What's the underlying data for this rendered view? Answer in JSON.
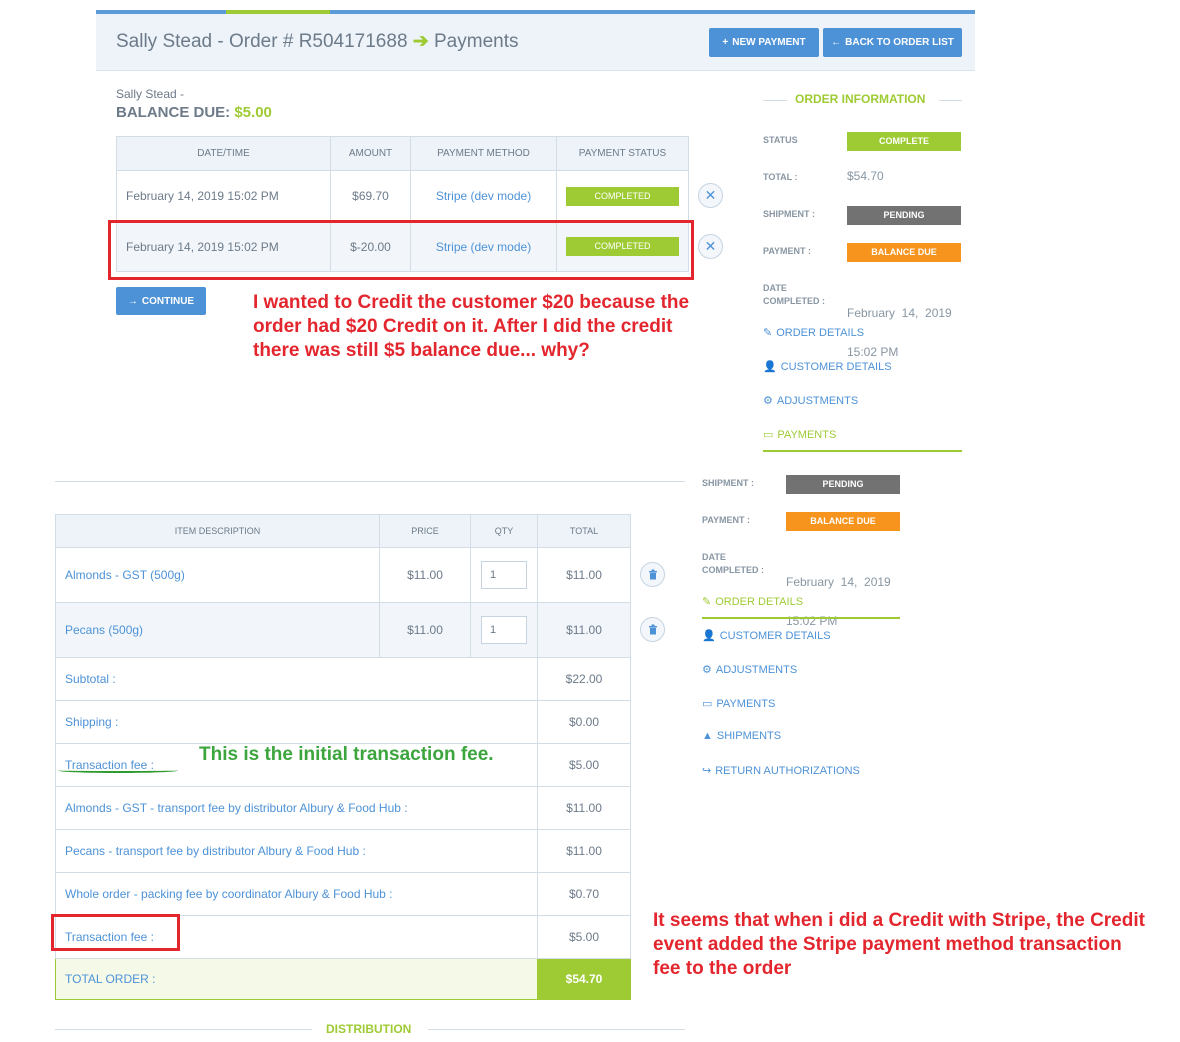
{
  "header": {
    "title_prefix": "Sally Stead - Order # R504171688",
    "title_arrow": "➔",
    "title_suffix": "Payments",
    "new_payment_label": "NEW PAYMENT",
    "back_label": "BACK TO ORDER LIST"
  },
  "balance": {
    "customer_line": "Sally Stead -",
    "label": "BALANCE DUE:",
    "amount": "$5.00"
  },
  "payments_table": {
    "headers": [
      "DATE/TIME",
      "AMOUNT",
      "PAYMENT METHOD",
      "PAYMENT STATUS"
    ],
    "rows": [
      {
        "datetime": "February 14, 2019 15:02 PM",
        "amount": "$69.70",
        "method": "Stripe (dev mode)",
        "status": "COMPLETED"
      },
      {
        "datetime": "February 14, 2019 15:02 PM",
        "amount": "$-20.00",
        "method": "Stripe (dev mode)",
        "status": "COMPLETED"
      }
    ]
  },
  "continue_label": "CONTINUE",
  "annotations": {
    "note1": "I wanted to Credit the customer $20 because the order had $20 Credit on it. After I did the credit there was still $5 balance due... why?",
    "note2": "This is the initial transaction fee.",
    "note3": "It seems that when i did a Credit with Stripe, the Credit event added the Stripe payment method transaction fee to the order"
  },
  "order_info": {
    "heading": "ORDER INFORMATION",
    "status_label": "STATUS",
    "status_value": "COMPLETE",
    "total_label": "TOTAL :",
    "total_value": "$54.70",
    "shipment_label": "SHIPMENT :",
    "shipment_value": "PENDING",
    "payment_label": "PAYMENT :",
    "payment_value": "BALANCE DUE",
    "date_label_1": "DATE",
    "date_label_2": "COMPLETED :",
    "date_value_1": "February  14,  2019",
    "date_value_2": "15:02 PM",
    "links": [
      "ORDER DETAILS",
      "CUSTOMER DETAILS",
      "ADJUSTMENTS",
      "PAYMENTS"
    ]
  },
  "order_info_2": {
    "shipment_label": "SHIPMENT :",
    "shipment_value": "PENDING",
    "payment_label": "PAYMENT :",
    "payment_value": "BALANCE DUE",
    "date_label_1": "DATE",
    "date_label_2": "COMPLETED :",
    "date_value_1": "February  14,  2019",
    "date_value_2": "15:02 PM",
    "links": [
      "ORDER DETAILS",
      "CUSTOMER DETAILS",
      "ADJUSTMENTS",
      "PAYMENTS",
      "SHIPMENTS",
      "RETURN AUTHORIZATIONS"
    ]
  },
  "items_table": {
    "headers": [
      "ITEM DESCRIPTION",
      "PRICE",
      "QTY",
      "TOTAL"
    ],
    "items": [
      {
        "description": "Almonds - GST (500g)",
        "price": "$11.00",
        "qty": "1",
        "total": "$11.00"
      },
      {
        "description": "Pecans (500g)",
        "price": "$11.00",
        "qty": "1",
        "total": "$11.00"
      }
    ],
    "summary": [
      {
        "label": "Subtotal :",
        "value": "$22.00"
      },
      {
        "label": "Shipping :",
        "value": "$0.00"
      },
      {
        "label": "Transaction fee :",
        "value": "$5.00"
      },
      {
        "label": "Almonds - GST - transport fee by distributor Albury & Food Hub :",
        "value": "$11.00"
      },
      {
        "label": "Pecans - transport fee by distributor Albury & Food Hub :",
        "value": "$11.00"
      },
      {
        "label": "Whole order - packing fee by coordinator Albury & Food Hub :",
        "value": "$0.70"
      },
      {
        "label": "Transaction fee :",
        "value": "$5.00"
      }
    ],
    "total_label": "TOTAL ORDER :",
    "total_value": "$54.70"
  },
  "distribution_heading": "DISTRIBUTION",
  "colors": {
    "accent_blue": "#4d92d7",
    "accent_green": "#9ecb34",
    "status_grey": "#727272",
    "status_orange": "#f7941d",
    "annotation_red": "#e3262e",
    "annotation_green": "#3da53d"
  }
}
